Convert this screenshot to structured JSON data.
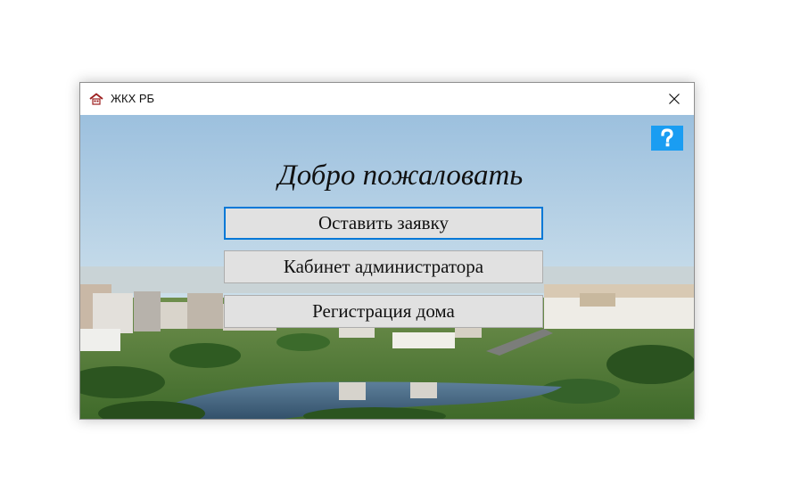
{
  "window": {
    "title": "ЖКХ РБ",
    "icon": "house-icon",
    "close_icon": "close-icon"
  },
  "main": {
    "help_icon": "question-mark-icon",
    "help_color": "#1a9df2",
    "welcome_text": "Добро пожаловать",
    "buttons": [
      {
        "label": "Оставить заявку",
        "focused": true
      },
      {
        "label": "Кабинет администратора",
        "focused": false
      },
      {
        "label": "Регистрация дома",
        "focused": false
      }
    ]
  },
  "colors": {
    "focus_border": "#0078d7",
    "button_bg": "#e1e1e1"
  }
}
